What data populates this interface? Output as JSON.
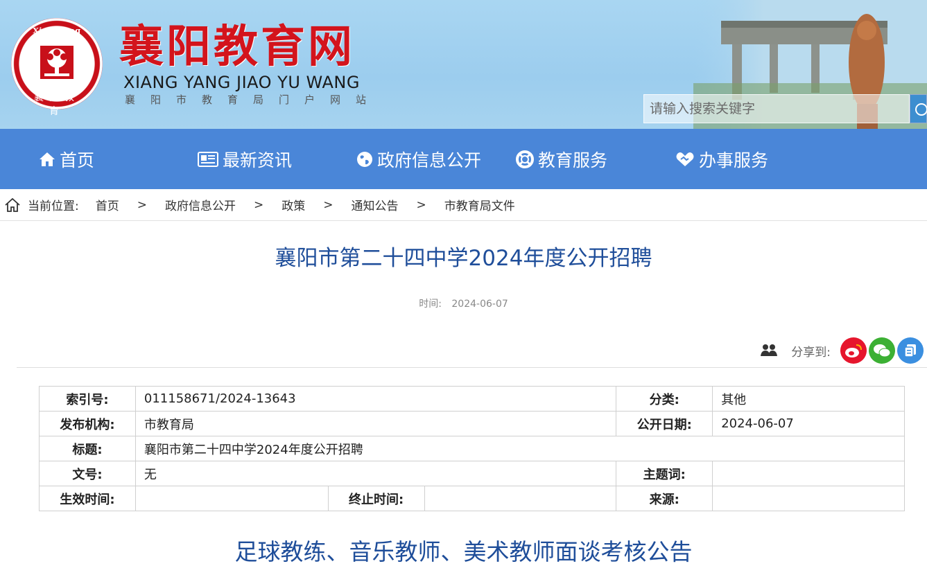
{
  "header": {
    "logo_ring_text": "Xiangyang Education",
    "logo_bottom_text": "襄阳教育",
    "title": "襄阳教育网",
    "pinyin": "XIANG YANG JIAO YU WANG",
    "subtitle": "襄阳市教育局门户网站",
    "search_placeholder": "请输入搜索关键字"
  },
  "nav": {
    "items": [
      {
        "label": "首页",
        "icon": "home-icon"
      },
      {
        "label": "最新资讯",
        "icon": "newspaper-icon"
      },
      {
        "label": "政府信息公开",
        "icon": "globe-icon"
      },
      {
        "label": "教育服务",
        "icon": "lifebuoy-icon"
      },
      {
        "label": "办事服务",
        "icon": "handshake-icon"
      }
    ]
  },
  "breadcrumb": {
    "prefix": "当前位置:",
    "items": [
      "首页",
      "政府信息公开",
      "政策",
      "通知公告",
      "市教育局文件"
    ],
    "separator": ">"
  },
  "article": {
    "title": "襄阳市第二十四中学2024年度公开招聘",
    "time_label": "时间:",
    "time_value": "2024-06-07",
    "share_label": "分享到:"
  },
  "meta": {
    "index_label": "索引号:",
    "index_value": "011158671/2024-13643",
    "category_label": "分类:",
    "category_value": "其他",
    "publisher_label": "发布机构:",
    "publisher_value": "市教育局",
    "pubdate_label": "公开日期:",
    "pubdate_value": "2024-06-07",
    "title_label": "标题:",
    "title_value": "襄阳市第二十四中学2024年度公开招聘",
    "docno_label": "文号:",
    "docno_value": "无",
    "keywords_label": "主题词:",
    "keywords_value": "",
    "effective_label": "生效时间:",
    "effective_value": "",
    "end_label": "终止时间:",
    "end_value": "",
    "source_label": "来源:",
    "source_value": ""
  },
  "content": {
    "subtitle": "足球教练、音乐教师、美术教师面谈考核公告"
  },
  "colors": {
    "nav_bg": "#4a86d8",
    "title_blue": "#1f4e9a",
    "brand_red": "#d3141c",
    "weibo": "#e6162d",
    "wechat": "#3cb034",
    "qzone": "#3b8fe0"
  }
}
